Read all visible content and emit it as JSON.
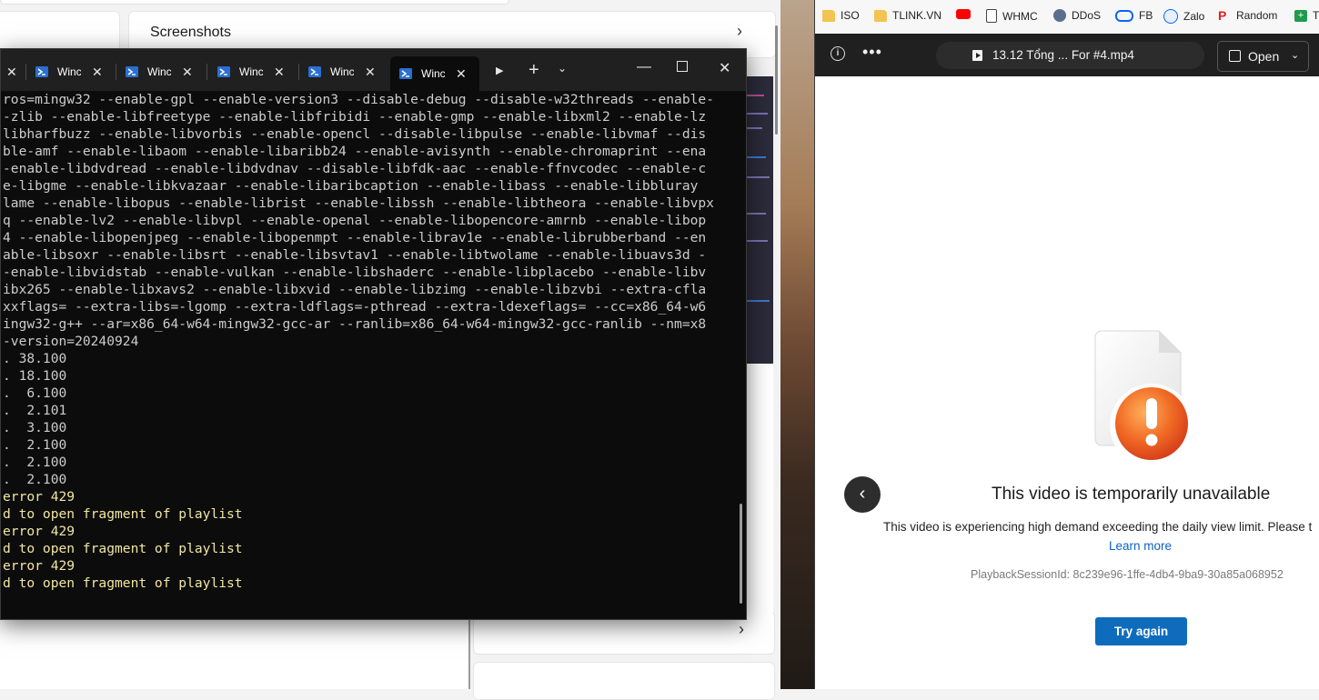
{
  "background_window": {
    "section_title": "Screenshots"
  },
  "terminal": {
    "tabs": [
      {
        "title": "Windows PowerShell",
        "active": false
      },
      {
        "title": "Windows PowerShell",
        "active": false
      },
      {
        "title": "Windows PowerShell",
        "active": false
      },
      {
        "title": "Windows PowerShell",
        "active": false
      },
      {
        "title": "Windows PowerShell",
        "active": true
      }
    ],
    "tab_truncated": [
      "Winc",
      "Winc",
      "Winc",
      "Winc",
      "Winc"
    ],
    "lines": [
      {
        "text": "ros=mingw32 --enable-gpl --enable-version3 --disable-debug --disable-w32threads --enable-",
        "color": "default"
      },
      {
        "text": "-zlib --enable-libfreetype --enable-libfribidi --enable-gmp --enable-libxml2 --enable-lz",
        "color": "default"
      },
      {
        "text": "libharfbuzz --enable-libvorbis --enable-opencl --disable-libpulse --enable-libvmaf --dis",
        "color": "default"
      },
      {
        "text": "ble-amf --enable-libaom --enable-libaribb24 --enable-avisynth --enable-chromaprint --ena",
        "color": "default"
      },
      {
        "text": "-enable-libdvdread --enable-libdvdnav --disable-libfdk-aac --enable-ffnvcodec --enable-c",
        "color": "default"
      },
      {
        "text": "e-libgme --enable-libkvazaar --enable-libaribcaption --enable-libass --enable-libbluray",
        "color": "default"
      },
      {
        "text": "lame --enable-libopus --enable-librist --enable-libssh --enable-libtheora --enable-libvpx",
        "color": "default"
      },
      {
        "text": "q --enable-lv2 --enable-libvpl --enable-openal --enable-libopencore-amrnb --enable-libop",
        "color": "default"
      },
      {
        "text": "4 --enable-libopenjpeg --enable-libopenmpt --enable-librav1e --enable-librubberband --en",
        "color": "default"
      },
      {
        "text": "able-libsoxr --enable-libsrt --enable-libsvtav1 --enable-libtwolame --enable-libuavs3d -",
        "color": "default"
      },
      {
        "text": "-enable-libvidstab --enable-vulkan --enable-libshaderc --enable-libplacebo --enable-libv",
        "color": "default"
      },
      {
        "text": "ibx265 --enable-libxavs2 --enable-libxvid --enable-libzimg --enable-libzvbi --extra-cfla",
        "color": "default"
      },
      {
        "text": "xxflags= --extra-libs=-lgomp --extra-ldflags=-pthread --extra-ldexeflags= --cc=x86_64-w6",
        "color": "default"
      },
      {
        "text": "ingw32-g++ --ar=x86_64-w64-mingw32-gcc-ar --ranlib=x86_64-w64-mingw32-gcc-ranlib --nm=x8",
        "color": "default"
      },
      {
        "text": "-version=20240924",
        "color": "default"
      },
      {
        "text": ". 38.100",
        "color": "default"
      },
      {
        "text": ". 18.100",
        "color": "default"
      },
      {
        "text": ".  6.100",
        "color": "default"
      },
      {
        "text": ".  2.101",
        "color": "default"
      },
      {
        "text": ".  3.100",
        "color": "default"
      },
      {
        "text": ".  2.100",
        "color": "default"
      },
      {
        "text": ".  2.100",
        "color": "default"
      },
      {
        "text": ".  2.100",
        "color": "default"
      },
      {
        "text": "error 429",
        "color": "yellow"
      },
      {
        "text": "d to open fragment of playlist",
        "color": "yellow"
      },
      {
        "text": "error 429",
        "color": "yellow"
      },
      {
        "text": "d to open fragment of playlist",
        "color": "yellow"
      },
      {
        "text": "error 429",
        "color": "yellow"
      },
      {
        "text": "d to open fragment of playlist",
        "color": "yellow"
      }
    ]
  },
  "browser": {
    "bookmarks": [
      {
        "label": "ISO",
        "icon": "folder-icon"
      },
      {
        "label": "TLINK.VN",
        "icon": "folder-icon"
      },
      {
        "label": "",
        "icon": "youtube-icon"
      },
      {
        "label": "WHMC",
        "icon": "page-icon"
      },
      {
        "label": "DDoS",
        "icon": "gear-icon"
      },
      {
        "label": "FB",
        "icon": "meta-icon"
      },
      {
        "label": "Zalo",
        "icon": "zalo-icon"
      },
      {
        "label": "Random",
        "icon": "random-icon"
      },
      {
        "label": "T",
        "icon": "plus-green-icon"
      }
    ],
    "video_title": "13.12 Tổng ... For #4.mp4",
    "open_label": "Open",
    "error_title": "This video is temporarily unavailable",
    "error_description": "This video is experiencing high demand exceeding the daily view limit. Please t",
    "learn_more": "Learn more",
    "session_id": "PlaybackSessionId: 8c239e96-1ffe-4db4-9ba9-30a85a068952",
    "try_again": "Try again"
  },
  "colors": {
    "terminal_bg": "#0c0c0c",
    "terminal_text": "#cccccc",
    "terminal_warning": "#f1e6a1",
    "accent": "#0f6cbd"
  }
}
